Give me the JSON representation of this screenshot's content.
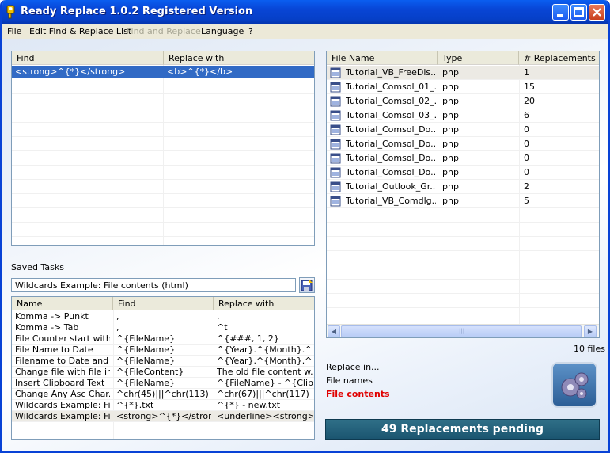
{
  "window": {
    "title": "Ready Replace 1.0.2 Registered Version"
  },
  "menu": [
    "File",
    "Edit Find & Replace List",
    "Find and Replace",
    "Language",
    "?"
  ],
  "find_replace": {
    "col_find": "Find",
    "col_replace": "Replace with",
    "rows": [
      {
        "find": "<strong>^{*}</strong>",
        "replace": "<b>^{*}</b>"
      }
    ]
  },
  "saved_tasks": {
    "label": "Saved Tasks",
    "current": "Wildcards Example: File contents (html)",
    "col_name": "Name",
    "col_find": "Find",
    "col_replace": "Replace with",
    "rows": [
      {
        "name": "Komma -> Punkt",
        "find": ",",
        "replace": "."
      },
      {
        "name": "Komma -> Tab",
        "find": ",",
        "replace": "^t"
      },
      {
        "name": "File Counter start with ...",
        "find": "^{FileName}",
        "replace": "^{###, 1, 2}"
      },
      {
        "name": "File Name to Date",
        "find": "^{FileName}",
        "replace": "^{Year}.^{Month}.^{D..."
      },
      {
        "name": "Filename to Date and ...",
        "find": "^{FileName}",
        "replace": "^{Year}.^{Month}.^{D..."
      },
      {
        "name": "Change file with file info",
        "find": "^{FileContent}",
        "replace": "The old file content w..."
      },
      {
        "name": "Insert Clipboard Text",
        "find": "^{FileName}",
        "replace": "^{FileName} - ^{Clipbo..."
      },
      {
        "name": "Change Any Asc Char...",
        "find": "^chr(45)|||^chr(113)",
        "replace": "^chr(67)|||^chr(117)"
      },
      {
        "name": "Wildcards Example: Fil...",
        "find": "^{*}.txt",
        "replace": "^{*} - new.txt"
      },
      {
        "name": "Wildcards Example: Fil...",
        "find": "<strong>^{*}</strong>",
        "replace": "<underline><strong>^{*..."
      }
    ]
  },
  "files": {
    "col_name": "File Name",
    "col_type": "Type",
    "col_count": "# Replacements",
    "rows": [
      {
        "name": "Tutorial_VB_FreeDis...",
        "type": "php",
        "count": "1"
      },
      {
        "name": "Tutorial_Comsol_01_...",
        "type": "php",
        "count": "15"
      },
      {
        "name": "Tutorial_Comsol_02_...",
        "type": "php",
        "count": "20"
      },
      {
        "name": "Tutorial_Comsol_03_...",
        "type": "php",
        "count": "6"
      },
      {
        "name": "Tutorial_Comsol_Do...",
        "type": "php",
        "count": "0"
      },
      {
        "name": "Tutorial_Comsol_Do...",
        "type": "php",
        "count": "0"
      },
      {
        "name": "Tutorial_Comsol_Do...",
        "type": "php",
        "count": "0"
      },
      {
        "name": "Tutorial_Comsol_Do...",
        "type": "php",
        "count": "0"
      },
      {
        "name": "Tutorial_Outlook_Gr...",
        "type": "php",
        "count": "2"
      },
      {
        "name": "Tutorial_VB_Comdlg...",
        "type": "php",
        "count": "5"
      }
    ],
    "count_label": "10 files"
  },
  "replace_in": {
    "label": "Replace in...",
    "option_file_names": "File names",
    "option_file_contents": "File contents",
    "active_color": "#e00000"
  },
  "status": {
    "pending": "49 Replacements pending"
  },
  "colors": {
    "titlebar": "#0a5ef0",
    "selection": "#316ac5",
    "status_bar": "#1b5570"
  }
}
